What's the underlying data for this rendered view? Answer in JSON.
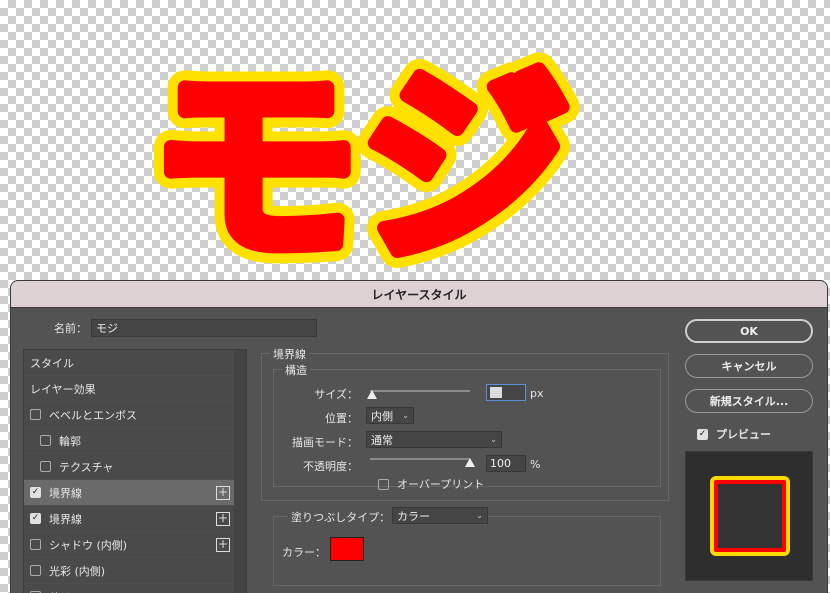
{
  "canvas": {
    "text": "モジ",
    "fill_color": "#ff0000",
    "inner_stroke_color": "#ff0000",
    "outer_stroke_color": "#ffe100"
  },
  "dialog": {
    "title": "レイヤースタイル",
    "name_label": "名前：",
    "name_value": "モジ"
  },
  "style_list": [
    {
      "label": "スタイル",
      "checkbox": false,
      "checked": false,
      "indent": false,
      "plus": false,
      "selected": false
    },
    {
      "label": "レイヤー効果",
      "checkbox": false,
      "checked": false,
      "indent": false,
      "plus": false,
      "selected": false
    },
    {
      "label": "ベベルとエンボス",
      "checkbox": true,
      "checked": false,
      "indent": false,
      "plus": false,
      "selected": false
    },
    {
      "label": "輪郭",
      "checkbox": true,
      "checked": false,
      "indent": true,
      "plus": false,
      "selected": false
    },
    {
      "label": "テクスチャ",
      "checkbox": true,
      "checked": false,
      "indent": true,
      "plus": false,
      "selected": false
    },
    {
      "label": "境界線",
      "checkbox": true,
      "checked": true,
      "indent": false,
      "plus": true,
      "selected": true
    },
    {
      "label": "境界線",
      "checkbox": true,
      "checked": true,
      "indent": false,
      "plus": true,
      "selected": false
    },
    {
      "label": "シャドウ (内側)",
      "checkbox": true,
      "checked": false,
      "indent": false,
      "plus": true,
      "selected": false
    },
    {
      "label": "光彩 (内側)",
      "checkbox": true,
      "checked": false,
      "indent": false,
      "plus": false,
      "selected": false
    },
    {
      "label": "サテン",
      "checkbox": true,
      "checked": false,
      "indent": false,
      "plus": false,
      "selected": false
    }
  ],
  "stroke_panel": {
    "group_title": "境界線",
    "structure_title": "構造",
    "size_label": "サイズ：",
    "size_value": "",
    "size_unit": "px",
    "size_slider_fraction": 0.02,
    "position_label": "位置：",
    "position_value": "内側",
    "blend_label": "描画モード：",
    "blend_value": "通常",
    "opacity_label": "不透明度：",
    "opacity_value": "100",
    "opacity_unit": "%",
    "opacity_slider_fraction": 1.0,
    "overprint_label": "オーバープリント",
    "fill_type_label": "塗りつぶしタイプ：",
    "fill_type_value": "カラー",
    "color_label": "カラー：",
    "color_value": "#ff0000"
  },
  "buttons": {
    "ok": "OK",
    "cancel": "キャンセル",
    "new_style": "新規スタイル...",
    "preview_label": "プレビュー",
    "preview_checked": true
  },
  "preview": {
    "swatch_fill": "#333333",
    "inner_stroke": "#ff0000",
    "outer_stroke": "#ffd700"
  }
}
